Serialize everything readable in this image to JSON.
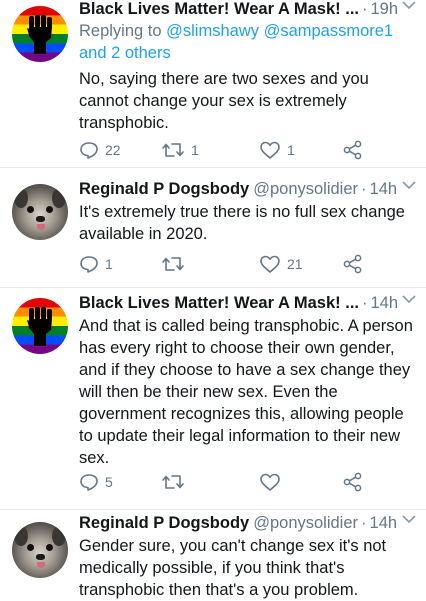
{
  "tweets": [
    {
      "name": "Black Lives Matter! Wear A Mask! ...",
      "handle": "",
      "time": "19h",
      "reply_prefix": "Replying to ",
      "reply_handles": "@slimshawy @sampassmore1",
      "reply_others": "and 2 others",
      "text": "No, saying there are two sexes and you cannot change your sex is extremely transphobic.",
      "replies": "22",
      "retweets": "1",
      "likes": "1",
      "avatar": "pride-fist-avatar"
    },
    {
      "name": "Reginald P Dogsbody",
      "handle": "@ponysolidier",
      "time": "14h",
      "text": "It's extremely true there is no full sex change available in 2020.",
      "replies": "1",
      "retweets": "",
      "likes": "21",
      "avatar": "dog-avatar"
    },
    {
      "name": "Black Lives Matter! Wear A Mask! ...",
      "handle": "",
      "time": "14h",
      "text": "And that is called being transphobic. A person has every right to choose their own gender, and if they choose to have a sex change they will then be their new sex. Even the government recognizes this, allowing people to update their legal information to their new sex.",
      "replies": "5",
      "retweets": "",
      "likes": "",
      "avatar": "pride-fist-avatar"
    },
    {
      "name": "Reginald P Dogsbody",
      "handle": "@ponysolidier",
      "time": "14h",
      "text": "Gender sure, you can't change sex it's not medically possible, if you think that's transphobic then that's a you problem.",
      "avatar": "dog-avatar"
    }
  ],
  "colors": {
    "link": "#1da1f2",
    "muted": "#657786",
    "text": "#14171a"
  }
}
